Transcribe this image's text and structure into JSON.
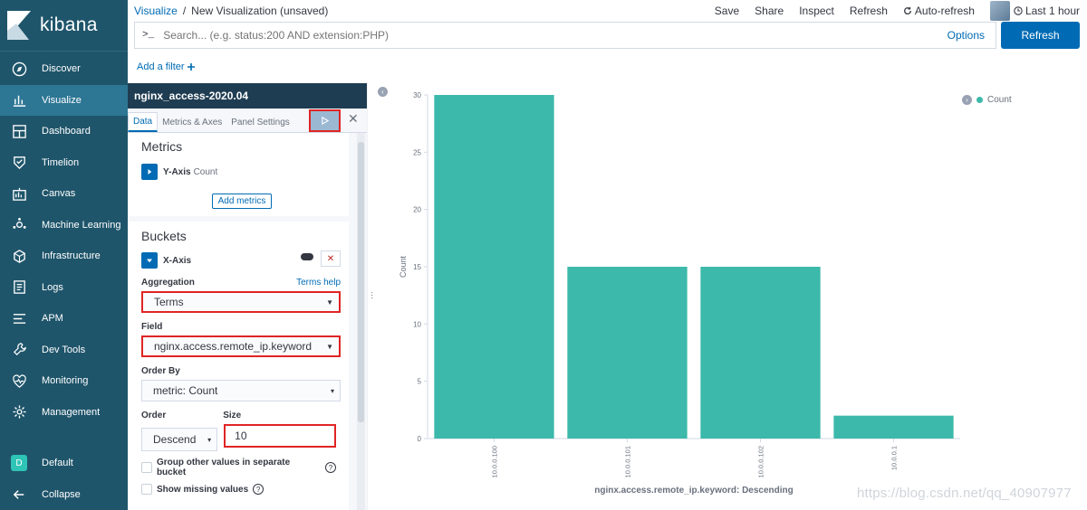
{
  "app": {
    "logo_text": "kibana"
  },
  "sidebar": {
    "items": [
      {
        "label": "Discover",
        "icon": "compass-icon"
      },
      {
        "label": "Visualize",
        "icon": "bar-chart-icon",
        "active": true
      },
      {
        "label": "Dashboard",
        "icon": "dashboard-icon"
      },
      {
        "label": "Timelion",
        "icon": "shield-icon"
      },
      {
        "label": "Canvas",
        "icon": "canvas-icon"
      },
      {
        "label": "Machine Learning",
        "icon": "ml-icon"
      },
      {
        "label": "Infrastructure",
        "icon": "infrastructure-icon"
      },
      {
        "label": "Logs",
        "icon": "logs-icon"
      },
      {
        "label": "APM",
        "icon": "apm-icon"
      },
      {
        "label": "Dev Tools",
        "icon": "wrench-icon"
      },
      {
        "label": "Monitoring",
        "icon": "heartbeat-icon"
      },
      {
        "label": "Management",
        "icon": "gear-icon"
      }
    ],
    "space": {
      "badge": "D",
      "label": "Default"
    },
    "collapse_label": "Collapse"
  },
  "breadcrumb": {
    "root": "Visualize",
    "sep": "/",
    "current": "New Visualization (unsaved)"
  },
  "top_actions": {
    "save": "Save",
    "share": "Share",
    "inspect": "Inspect",
    "refresh": "Refresh",
    "auto_refresh": "Auto-refresh",
    "time_range": "Last 1 hour"
  },
  "query": {
    "prompt": ">_",
    "placeholder": "Search... (e.g. status:200 AND extension:PHP)",
    "options": "Options",
    "refresh_button": "Refresh"
  },
  "filter": {
    "add_filter": "Add a filter"
  },
  "editor": {
    "index_pattern": "nginx_access-2020.04",
    "tabs": [
      "Data",
      "Metrics & Axes",
      "Panel Settings"
    ],
    "metrics": {
      "title": "Metrics",
      "y_axis_label": "Y-Axis",
      "y_axis_agg": "Count",
      "add_metrics": "Add metrics"
    },
    "buckets": {
      "title": "Buckets",
      "x_axis_label": "X-Axis",
      "aggregation_label": "Aggregation",
      "terms_help": "Terms help",
      "aggregation_value": "Terms",
      "field_label": "Field",
      "field_value": "nginx.access.remote_ip.keyword",
      "order_by_label": "Order By",
      "order_by_value": "metric: Count",
      "order_label": "Order",
      "order_value": "Descend",
      "size_label": "Size",
      "size_value": "10",
      "group_other": "Group other values in separate bucket",
      "show_missing": "Show missing values"
    }
  },
  "chart_data": {
    "type": "bar",
    "categories": [
      "10.0.0.100",
      "10.0.0.101",
      "10.0.0.102",
      "10.0.0.1"
    ],
    "values": [
      30,
      15,
      15,
      2
    ],
    "xlabel": "nginx.access.remote_ip.keyword: Descending",
    "ylabel": "Count",
    "ylim": [
      0,
      30
    ],
    "yticks": [
      0,
      5,
      10,
      15,
      20,
      25,
      30
    ],
    "legend": {
      "entries": [
        "Count"
      ],
      "placement": "top-right"
    },
    "color": "#3cb9aa",
    "grid": false
  },
  "watermark": "https://blog.csdn.net/qq_40907977"
}
